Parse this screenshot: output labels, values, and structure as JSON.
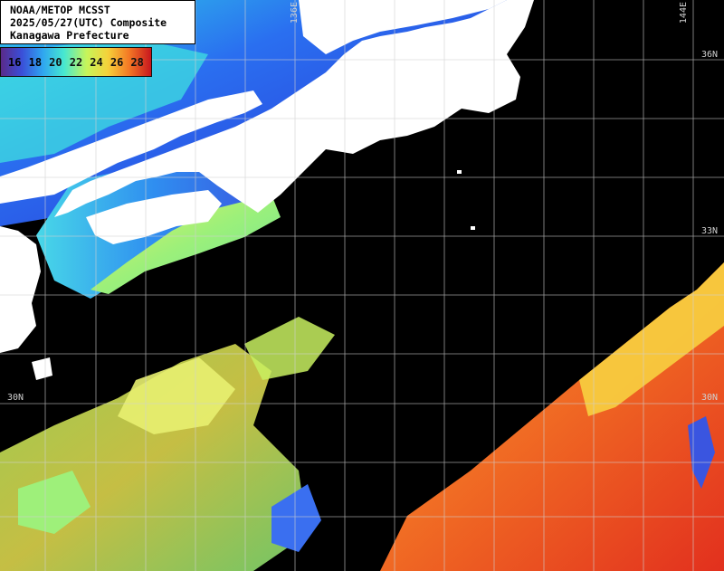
{
  "header": {
    "line1": "NOAA/METOP MCSST",
    "line2": "2025/05/27(UTC) Composite",
    "line3": "Kanagawa Prefecture"
  },
  "legend": {
    "labels": [
      "16",
      "18",
      "20",
      "22",
      "24",
      "26",
      "28"
    ]
  },
  "grid_labels": {
    "lat_36": "36N",
    "lat_33": "33N",
    "lat_30_left": "30N",
    "lat_30_right": "30N",
    "lon_136": "136E",
    "lon_144": "144E"
  },
  "colors": {
    "land": "#ffffff",
    "no_data": "#000000",
    "grid": "#d0d0d0",
    "sst_cold": "#3a4fd8",
    "sst_mid": "#c6f55a",
    "sst_warm": "#f47a25",
    "sst_hot": "#c8161e"
  }
}
